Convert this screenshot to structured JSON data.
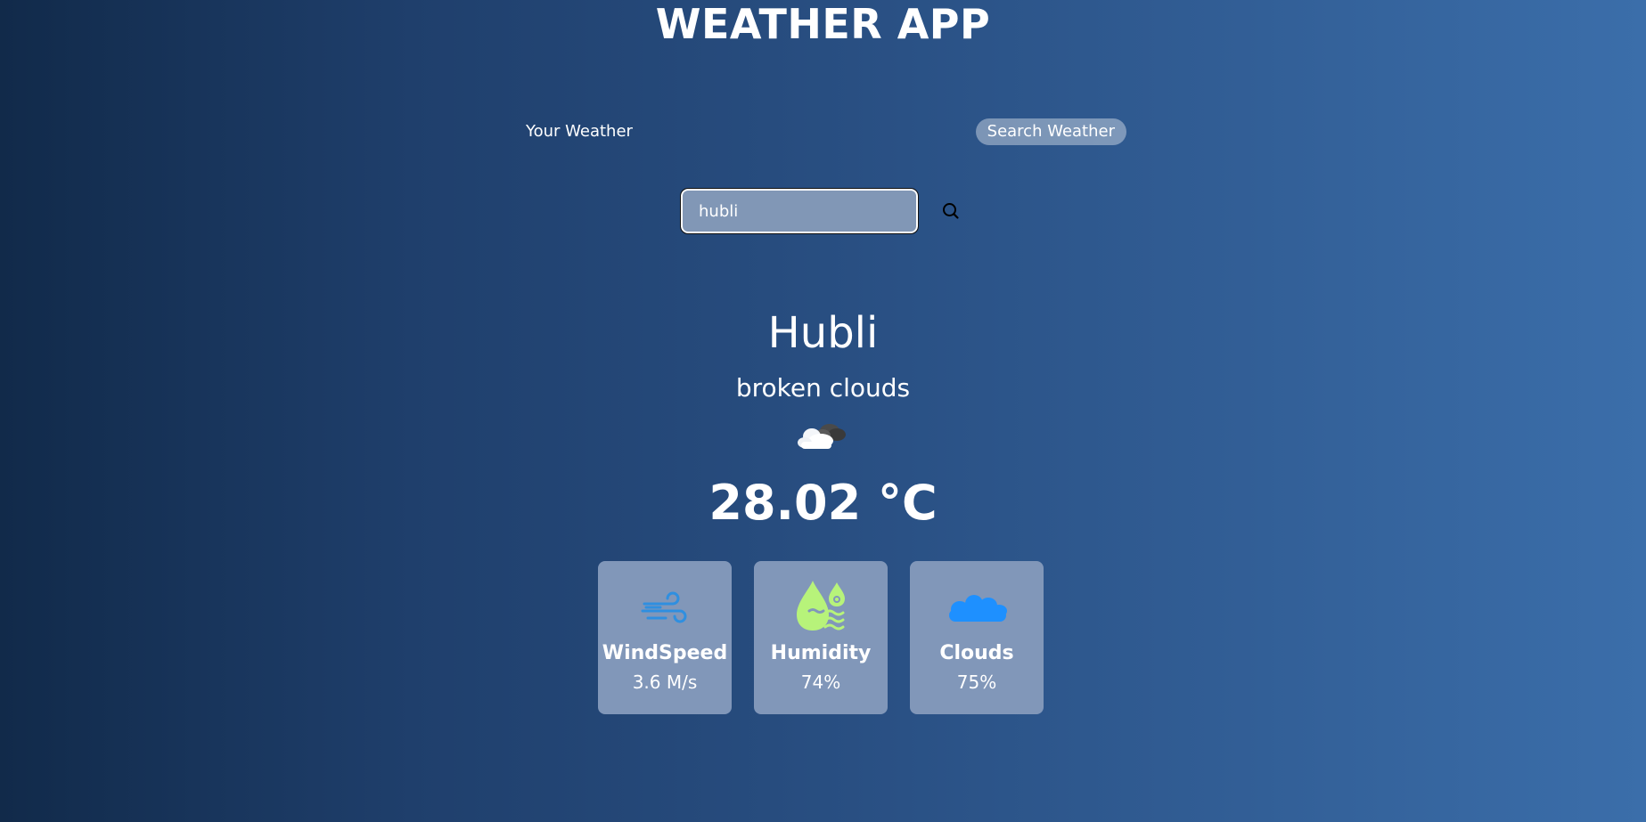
{
  "app": {
    "title": "WEATHER APP"
  },
  "tabs": {
    "your_weather": "Your Weather",
    "search_weather": "Search Weather"
  },
  "search": {
    "value": "hubli",
    "icon": "search-icon"
  },
  "weather": {
    "city": "Hubli",
    "description": "broken clouds",
    "icon": "broken-clouds-icon",
    "temperature": "28.02 °C"
  },
  "cards": [
    {
      "label": "WindSpeed",
      "value": "3.6 M/s",
      "icon": "wind-icon",
      "icon_color": "#2f8fe0"
    },
    {
      "label": "Humidity",
      "value": "74%",
      "icon": "humidity-icon",
      "icon_color": "#b7f37a"
    },
    {
      "label": "Clouds",
      "value": "75%",
      "icon": "cloud-icon",
      "icon_color": "#1e90ff"
    }
  ],
  "colors": {
    "background_start": "#112a4a",
    "background_end": "#3b6eaa",
    "card_background": "#8197b9",
    "active_tab_background": "#9aabc4"
  }
}
